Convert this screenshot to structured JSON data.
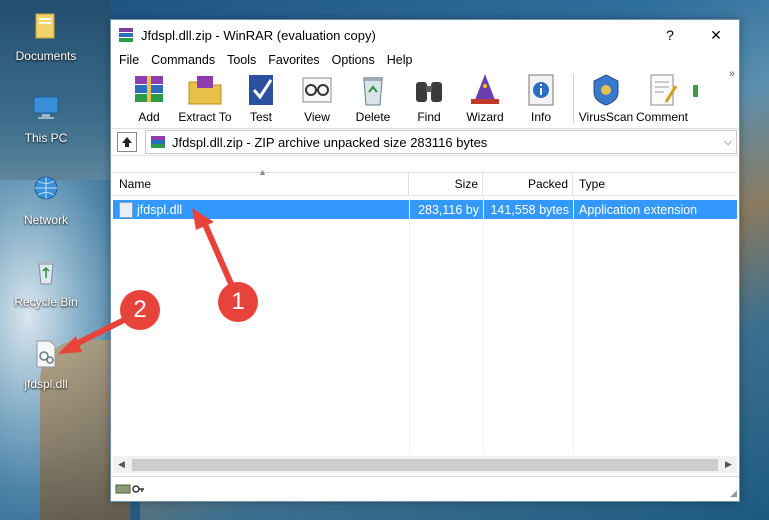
{
  "desktop": {
    "icons": [
      {
        "label": "Documents",
        "icon": "folder-icon"
      },
      {
        "label": "This PC",
        "icon": "computer-icon"
      },
      {
        "label": "Network",
        "icon": "network-icon"
      },
      {
        "label": "Recycle Bin",
        "icon": "recycle-bin-icon"
      },
      {
        "label": "jfdspl.dll",
        "icon": "dll-file-icon"
      }
    ]
  },
  "window": {
    "title": "Jfdspl.dll.zip - WinRAR (evaluation copy)",
    "help_btn": "?",
    "close_btn": "✕"
  },
  "menu": [
    "File",
    "Commands",
    "Tools",
    "Favorites",
    "Options",
    "Help"
  ],
  "toolbar": [
    {
      "label": "Add",
      "icon": "add-archive-icon"
    },
    {
      "label": "Extract To",
      "icon": "extract-folder-icon"
    },
    {
      "label": "Test",
      "icon": "test-checkmark-icon"
    },
    {
      "label": "View",
      "icon": "view-glasses-icon"
    },
    {
      "label": "Delete",
      "icon": "delete-recycle-icon"
    },
    {
      "label": "Find",
      "icon": "find-binoculars-icon"
    },
    {
      "label": "Wizard",
      "icon": "wizard-hat-icon"
    },
    {
      "label": "Info",
      "icon": "info-icon"
    },
    {
      "label": "VirusScan",
      "icon": "virusscan-icon"
    },
    {
      "label": "Comment",
      "icon": "comment-pen-icon"
    }
  ],
  "more_chevron": "»",
  "address": {
    "text": "Jfdspl.dll.zip - ZIP archive unpacked size 283116 bytes",
    "dropdown": "⌵"
  },
  "columns": {
    "name": "Name",
    "size": "Size",
    "packed": "Packed",
    "type": "Type"
  },
  "files": [
    {
      "name": "jfdspl.dll",
      "size": "283,116 by",
      "packed": "141,558 bytes",
      "type": "Application extension",
      "selected": true
    }
  ],
  "callouts": [
    {
      "num": "1"
    },
    {
      "num": "2"
    }
  ],
  "colors": {
    "accent_red": "#e8433a",
    "selection_blue": "#3399ff"
  }
}
